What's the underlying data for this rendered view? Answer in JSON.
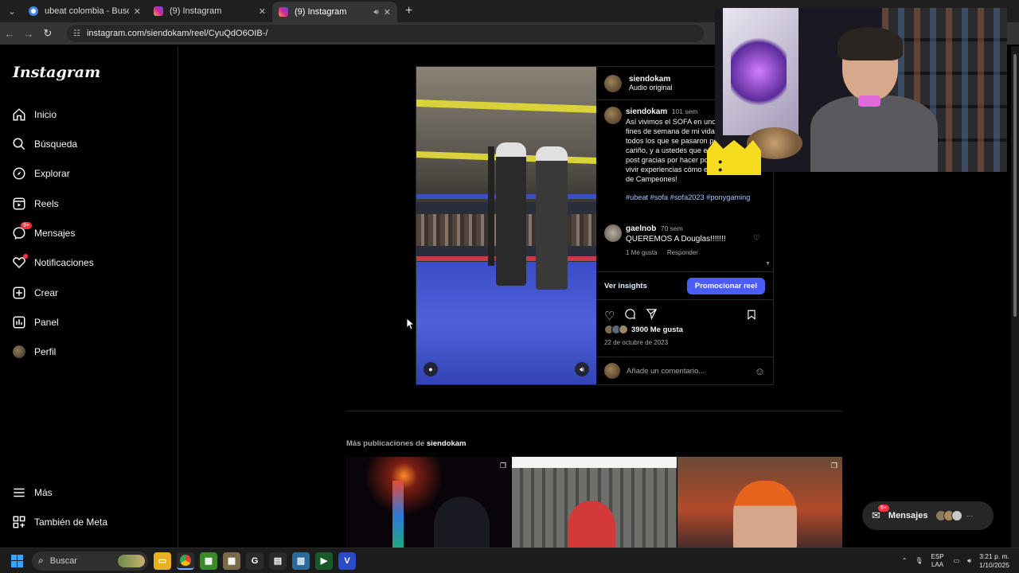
{
  "browser": {
    "tabs": [
      {
        "title": "ubeat colombia - Buscar con Go",
        "favicon_color": "#4285f4"
      },
      {
        "title": "(9) Instagram",
        "favicon_color": "#d6249f"
      },
      {
        "title": "(9) Instagram",
        "favicon_color": "#d6249f"
      }
    ],
    "url": "instagram.com/siendokam/reel/CyuQdO6OIB-/"
  },
  "sidebar": {
    "logo": "Instagram",
    "items": [
      {
        "label": "Inicio",
        "icon": "home-icon"
      },
      {
        "label": "Búsqueda",
        "icon": "search-icon"
      },
      {
        "label": "Explorar",
        "icon": "compass-icon"
      },
      {
        "label": "Reels",
        "icon": "reels-icon"
      },
      {
        "label": "Mensajes",
        "icon": "messenger-icon",
        "badge": "9+"
      },
      {
        "label": "Notificaciones",
        "icon": "heart-icon"
      },
      {
        "label": "Crear",
        "icon": "plus-square-icon"
      },
      {
        "label": "Panel",
        "icon": "chart-icon"
      },
      {
        "label": "Perfil",
        "icon": "avatar-icon"
      }
    ],
    "more": "Más",
    "meta": "También de Meta"
  },
  "post": {
    "username": "siendokam",
    "audio": "Audio original",
    "caption": {
      "username": "siendokam",
      "time": "101 sem",
      "text": "Así vivimos el SOFA en uno de los mejores fines de semana de mi vida, gracias a todos los que se pasaron por allá, por tanto cariño, y a ustedes que están leyendo este post gracias por hacer posible que pueda vivir experiencias cómo está! pura energía de Campeones!",
      "hashtags": [
        "#ubeat",
        "#sofa",
        "#sofa2023",
        "#ponygaming"
      ]
    },
    "comment": {
      "username": "gaelnob",
      "time": "70 sem",
      "text": "QUEREMOS A Douglas!!!!!!!",
      "likes_label": "1 Me gusta",
      "reply_label": "Responder"
    },
    "insights_label": "Ver insights",
    "promote_label": "Promocionar reel",
    "likes": "3900 Me gusta",
    "date": "22 de octubre de 2023",
    "comment_placeholder": "Añade un comentario..."
  },
  "more_posts": {
    "prefix": "Más publicaciones de",
    "username": "siendokam"
  },
  "messages_pill": {
    "label": "Mensajes",
    "badge": "9+"
  },
  "taskbar": {
    "search_placeholder": "Buscar",
    "lang_top": "ESP",
    "lang_bottom": "LAA",
    "time": "3:21 p. m.",
    "date": "1/10/2025"
  },
  "colors": {
    "accent_blue": "#4a5df9",
    "notification_red": "#ff3040",
    "background": "#000000"
  }
}
